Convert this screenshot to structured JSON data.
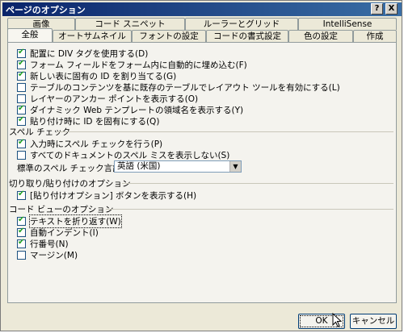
{
  "window": {
    "title": "ページのオプション",
    "help_button": "?",
    "close_button": "X"
  },
  "tabs_back": [
    "画像",
    "コード スニペット",
    "ルーラーとグリッド",
    "IntelliSense"
  ],
  "tabs_front": [
    "全般",
    "オートサムネイル",
    "フォントの設定",
    "コードの書式設定",
    "色の設定",
    "作成"
  ],
  "active_tab": "全般",
  "general": [
    {
      "label": "配置に DIV タグを使用する(D)",
      "checked": true
    },
    {
      "label": "フォーム フィールドをフォーム内に自動的に埋め込む(F)",
      "checked": true
    },
    {
      "label": "新しい表に固有の ID を割り当てる(G)",
      "checked": true
    },
    {
      "label": "テーブルのコンテンツを基に既存のテーブルでレイアウト ツールを有効にする(L)",
      "checked": false
    },
    {
      "label": "レイヤーのアンカー ポイントを表示する(O)",
      "checked": false
    },
    {
      "label": "ダイナミック Web テンプレートの領域名を表示する(Y)",
      "checked": true
    },
    {
      "label": "貼り付け時に ID を固有にする(Q)",
      "checked": true
    }
  ],
  "spell": {
    "title": "スペル チェック",
    "items": [
      {
        "label": "入力時にスペル チェックを行う(P)",
        "checked": true
      },
      {
        "label": "すべてのドキュメントのスペル ミスを表示しない(S)",
        "checked": false
      }
    ],
    "language_label": "標準のスペル チェック言語(E):",
    "language_value": "英語 (米国)"
  },
  "paste": {
    "title": "切り取り/貼り付けのオプション",
    "items": [
      {
        "label": "[貼り付けオプション] ボタンを表示する(H)",
        "checked": true
      }
    ]
  },
  "codeview": {
    "title": "コード ビューのオプション",
    "items": [
      {
        "label": "テキストを折り返す(W)",
        "checked": true
      },
      {
        "label": "自動インデント(I)",
        "checked": true
      },
      {
        "label": "行番号(N)",
        "checked": true
      },
      {
        "label": "マージン(M)",
        "checked": false
      }
    ]
  },
  "buttons": {
    "ok": "OK",
    "cancel": "キャンセル"
  }
}
